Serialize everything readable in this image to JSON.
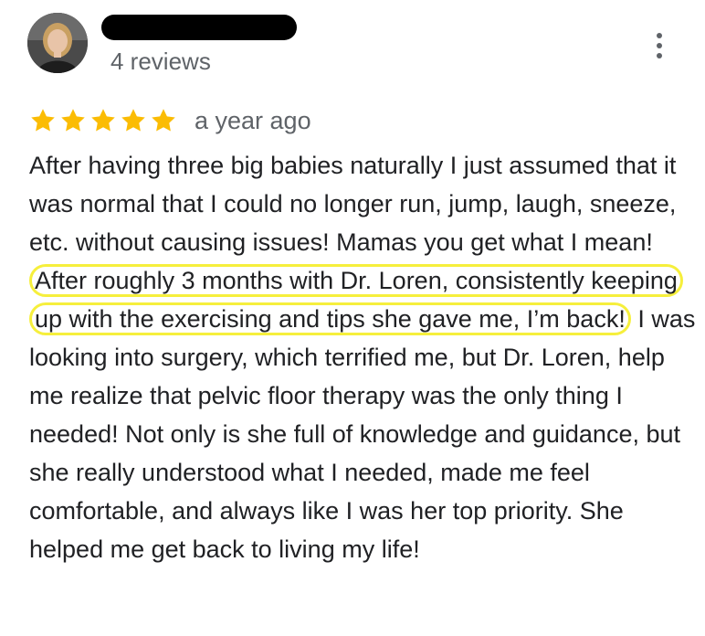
{
  "reviewer": {
    "avatar_icon": "user-photo-avatar",
    "review_count": "4 reviews"
  },
  "menu": {
    "icon": "more-vertical-icon"
  },
  "rating": {
    "stars": 5,
    "max": 5,
    "star_color": "#fbbc04",
    "date": "a year ago"
  },
  "review": {
    "text_before": "After having three big babies naturally I just assumed that it was normal that I could no longer run, jump, laugh, sneeze, etc. without causing issues! Mamas you get what I mean! ",
    "highlighted": "After roughly 3 months with Dr. Loren, consistently keeping up with the exercising and tips she gave me, I’m back!",
    "text_after": " I was looking into surgery, which terrified me, but Dr. Loren, help me realize that pelvic floor therapy was the only thing I needed! Not only is she full of knowledge and guidance, but she really understood what I needed, made me feel comfortable, and always like I was her top priority. She helped me get back to living my life!",
    "highlight_color": "#f6ef3c"
  }
}
